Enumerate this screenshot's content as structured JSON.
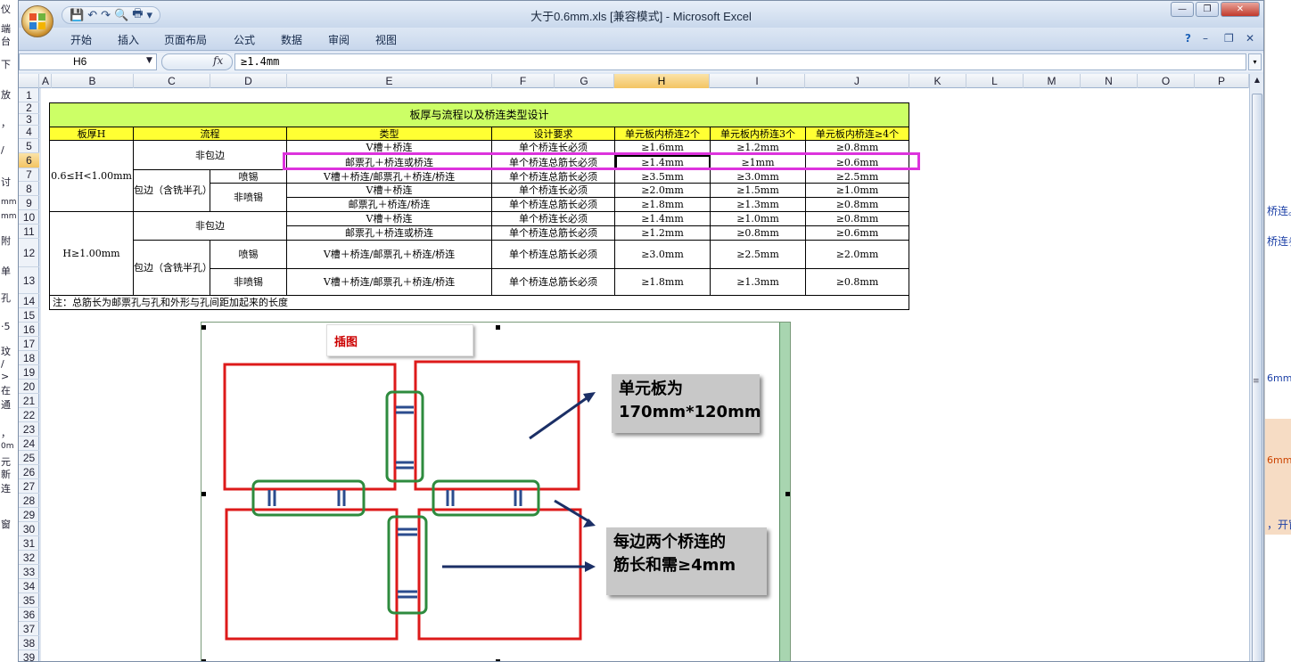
{
  "window": {
    "title": "大于0.6mm.xls  [兼容模式] - Microsoft Excel",
    "controls": {
      "minimize": "—",
      "restore": "❐",
      "close": "✕"
    }
  },
  "qat": {
    "save": "💾",
    "undo": "↶",
    "redo": "↷",
    "preview": "🔍",
    "print": "🖶",
    "more": "▾"
  },
  "ribbon_tabs": [
    "开始",
    "插入",
    "页面布局",
    "公式",
    "数据",
    "审阅",
    "视图"
  ],
  "ribbon_right": {
    "help": "?",
    "min": "–",
    "restore": "❐",
    "close": "✕"
  },
  "formula_bar": {
    "name_box": "H6",
    "fx": "fx",
    "value": "≥1.4mm"
  },
  "columns": [
    "A",
    "B",
    "C",
    "D",
    "E",
    "F",
    "G",
    "H",
    "I",
    "J",
    "K",
    "L",
    "M",
    "N",
    "O",
    "P"
  ],
  "selected_column": "H",
  "selected_row": "6",
  "rows": [
    "1",
    "2",
    "3",
    "4",
    "5",
    "6",
    "7",
    "8",
    "9",
    "10",
    "11",
    "12",
    "13",
    "14",
    "15",
    "16",
    "17",
    "18",
    "19",
    "20",
    "21",
    "22",
    "23",
    "24",
    "25",
    "26",
    "27",
    "28",
    "29",
    "30",
    "31",
    "32",
    "33",
    "34",
    "35",
    "36",
    "37",
    "38",
    "39"
  ],
  "table": {
    "title": "板厚与流程以及桥连类型设计",
    "headers": {
      "thickness": "板厚H",
      "process": "流程",
      "type": "类型",
      "requirement": "设计要求",
      "bridge2": "单元板内桥连2个",
      "bridge3": "单元板内桥连3个",
      "bridge4": "单元板内桥连≥4个"
    },
    "group1": {
      "thickness": "0.6≤H<1.00mm",
      "no_wrap": "非包边",
      "wrap": "包边（含铣半孔）",
      "spray": "喷锡",
      "no_spray": "非喷锡",
      "rows": [
        {
          "type": "V槽＋桥连",
          "req": "单个桥连长必须",
          "b2": "≥1.6mm",
          "b3": "≥1.2mm",
          "b4": "≥0.8mm"
        },
        {
          "type": "邮票孔＋桥连或桥连",
          "req": "单个桥连总筋长必须",
          "b2": "≥1.4mm",
          "b3": "≥1mm",
          "b4": "≥0.6mm"
        },
        {
          "type": "V槽＋桥连/邮票孔＋桥连/桥连",
          "req": "单个桥连总筋长必须",
          "b2": "≥3.5mm",
          "b3": "≥3.0mm",
          "b4": "≥2.5mm"
        },
        {
          "type": "V槽＋桥连",
          "req": "单个桥连长必须",
          "b2": "≥2.0mm",
          "b3": "≥1.5mm",
          "b4": "≥1.0mm"
        },
        {
          "type": "邮票孔＋桥连/桥连",
          "req": "单个桥连总筋长必须",
          "b2": "≥1.8mm",
          "b3": "≥1.3mm",
          "b4": "≥0.8mm"
        }
      ]
    },
    "group2": {
      "thickness": "H≥1.00mm",
      "no_wrap": "非包边",
      "wrap": "包边（含铣半孔）",
      "spray": "喷锡",
      "no_spray": "非喷锡",
      "rows": [
        {
          "type": "V槽＋桥连",
          "req": "单个桥连长必须",
          "b2": "≥1.4mm",
          "b3": "≥1.0mm",
          "b4": "≥0.8mm"
        },
        {
          "type": "邮票孔＋桥连或桥连",
          "req": "单个桥连总筋长必须",
          "b2": "≥1.2mm",
          "b3": "≥0.8mm",
          "b4": "≥0.6mm"
        },
        {
          "type": "V槽＋桥连/邮票孔＋桥连/桥连",
          "req": "单个桥连总筋长必须",
          "b2": "≥3.0mm",
          "b3": "≥2.5mm",
          "b4": "≥2.0mm"
        },
        {
          "type": "V槽＋桥连/邮票孔＋桥连/桥连",
          "req": "单个桥连总筋长必须",
          "b2": "≥1.8mm",
          "b3": "≥1.3mm",
          "b4": "≥0.8mm"
        }
      ]
    },
    "note": "注：总筋长为邮票孔与孔和外形与孔间距加起来的长度"
  },
  "picture": {
    "caption": "插图",
    "callout1": [
      "单元板为",
      "170mm*120mm"
    ],
    "callout2": [
      "每边两个桥连的",
      "筋长和需≥4mm"
    ]
  },
  "colors": {
    "title_bg": "#ccff66",
    "header_bg": "#ffff33",
    "highlight": "#dd33dd",
    "board_red": "#dd1a1a",
    "bridge_green": "#2e8b3e"
  },
  "background_text": {
    "left": [
      "仪",
      "端",
      "台",
      "下",
      "放",
      "，",
      "/",
      "讨",
      "mm",
      "mm",
      "附",
      "单",
      "孔",
      "·5",
      "玟",
      "/",
      ">",
      "在",
      "通",
      "，",
      "0m",
      "元",
      "新",
      "连",
      "窗"
    ],
    "right": [
      "桥连。",
      "桥连参",
      "6mm",
      "6mm",
      "，开窗"
    ]
  }
}
